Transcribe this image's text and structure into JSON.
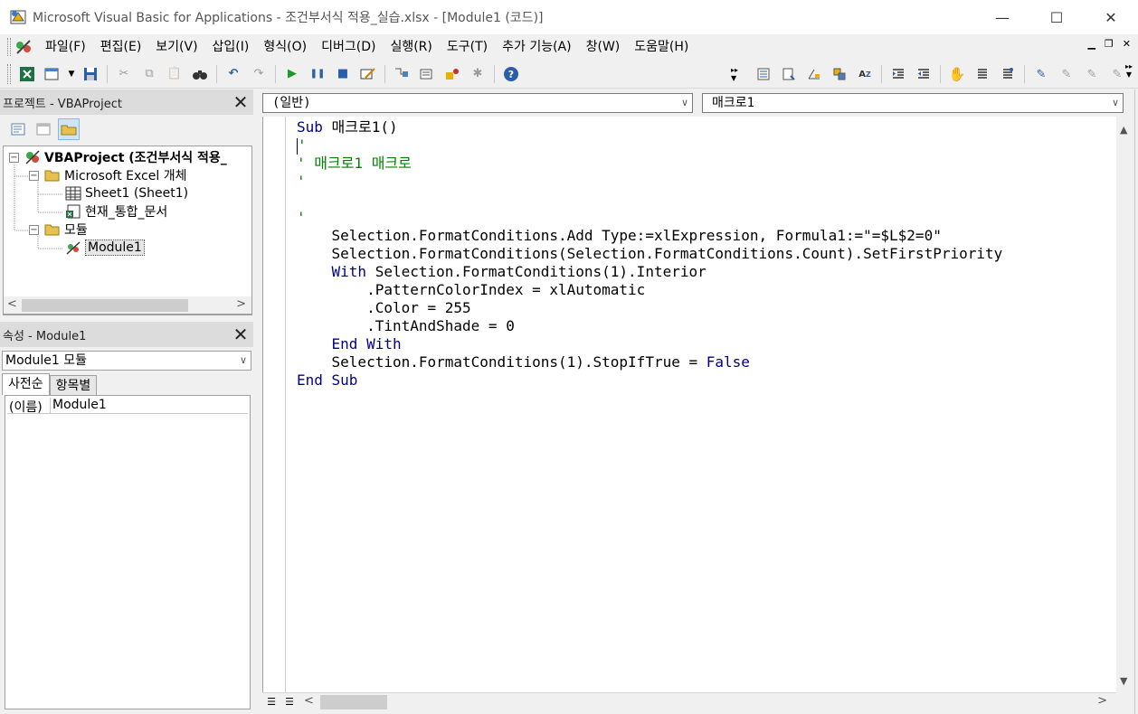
{
  "window": {
    "title": "Microsoft Visual Basic for Applications - 조건부서식 적용_실습.xlsx - [Module1 (코드)]",
    "minimize": "—",
    "maximize": "☐",
    "close": "✕"
  },
  "menu": {
    "items": [
      "파일(F)",
      "편집(E)",
      "보기(V)",
      "삽입(I)",
      "형식(O)",
      "디버그(D)",
      "실행(R)",
      "도구(T)",
      "추가 기능(A)",
      "창(W)",
      "도움말(H)"
    ]
  },
  "project_explorer": {
    "title": "프로젝트 - VBAProject",
    "tree": {
      "root": "VBAProject (조건부서식 적용_",
      "folder_objects": "Microsoft Excel 개체",
      "sheet1": "Sheet1 (Sheet1)",
      "workbook": "현재_통합_문서",
      "folder_modules": "모듈",
      "module1": "Module1"
    }
  },
  "properties": {
    "title": "속성 - Module1",
    "selected_object": "Module1 모듈",
    "tabs": [
      "사전순",
      "항목별"
    ],
    "rows": [
      {
        "name": "(이름)",
        "value": "Module1"
      }
    ]
  },
  "code_window": {
    "object_combo": "(일반)",
    "procedure_combo": "매크로1",
    "lines": [
      {
        "k": "Sub",
        "t": " 매크로1()"
      },
      {
        "c": "'"
      },
      {
        "c": "' 매크로1 매크로"
      },
      {
        "c": "'"
      },
      {
        "t": ""
      },
      {
        "c": "'"
      },
      {
        "t": "    Selection.FormatConditions.Add Type:=xlExpression, Formula1:=\"=$L$2=0\""
      },
      {
        "t": "    Selection.FormatConditions(Selection.FormatConditions.Count).SetFirstPriority"
      },
      {
        "k": "    With",
        "t": " Selection.FormatConditions(1).Interior"
      },
      {
        "t": "        .PatternColorIndex = xlAutomatic"
      },
      {
        "t": "        .Color = 255"
      },
      {
        "t": "        .TintAndShade = 0"
      },
      {
        "k": "    End With",
        "t": ""
      },
      {
        "t": "    Selection.FormatConditions(1).StopIfTrue = ",
        "k2": "False"
      },
      {
        "k": "End Sub",
        "t": ""
      }
    ]
  },
  "colors": {
    "keyword": "#00008b",
    "comment": "#008000"
  }
}
